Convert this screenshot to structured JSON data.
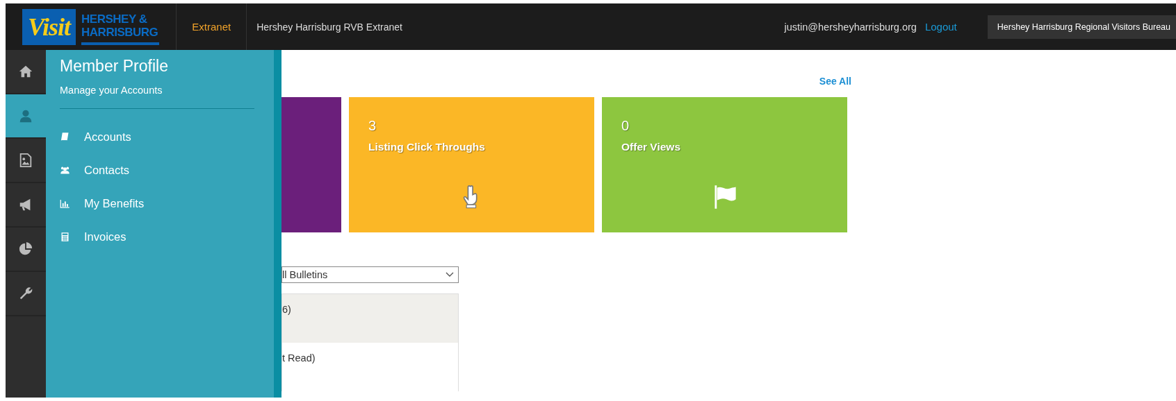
{
  "header": {
    "logo": {
      "script": "Visit",
      "line_1": "HERSHEY &",
      "line_2": "HARRISBURG"
    },
    "section": "Extranet",
    "title": "Hershey Harrisburg RVB Extranet",
    "user": "justin@hersheyharrisburg.org",
    "logout": "Logout",
    "organization": "Hershey Harrisburg Regional Visitors Bureau"
  },
  "rail": [
    {
      "kind": "home",
      "selected": false
    },
    {
      "kind": "user",
      "selected": true
    },
    {
      "kind": "image",
      "selected": false
    },
    {
      "kind": "megaphone",
      "selected": false
    },
    {
      "kind": "pie",
      "selected": false
    },
    {
      "kind": "wrench",
      "selected": false
    }
  ],
  "flyout": {
    "title": "Member Profile",
    "subtitle": "Manage your Accounts",
    "items": [
      {
        "kind": "book",
        "label": "Accounts"
      },
      {
        "kind": "people",
        "label": "Contacts"
      },
      {
        "kind": "chart",
        "label": "My Benefits"
      },
      {
        "kind": "calculator",
        "label": "Invoices"
      }
    ]
  },
  "see_all": "See All",
  "cards": [
    {
      "color": "#6b1f7b"
    },
    {
      "color": "#fbb726",
      "value": "3",
      "label": "Listing Click Throughs",
      "kind": "hand"
    },
    {
      "color": "#8dc63f",
      "value": "0",
      "label": "Offer Views",
      "kind": "flag"
    }
  ],
  "bulletins": {
    "filter": "ll Bulletins",
    "rows": [
      {
        "text": "6)",
        "selected": true
      },
      {
        "text": "t Read)",
        "selected": false
      }
    ]
  }
}
